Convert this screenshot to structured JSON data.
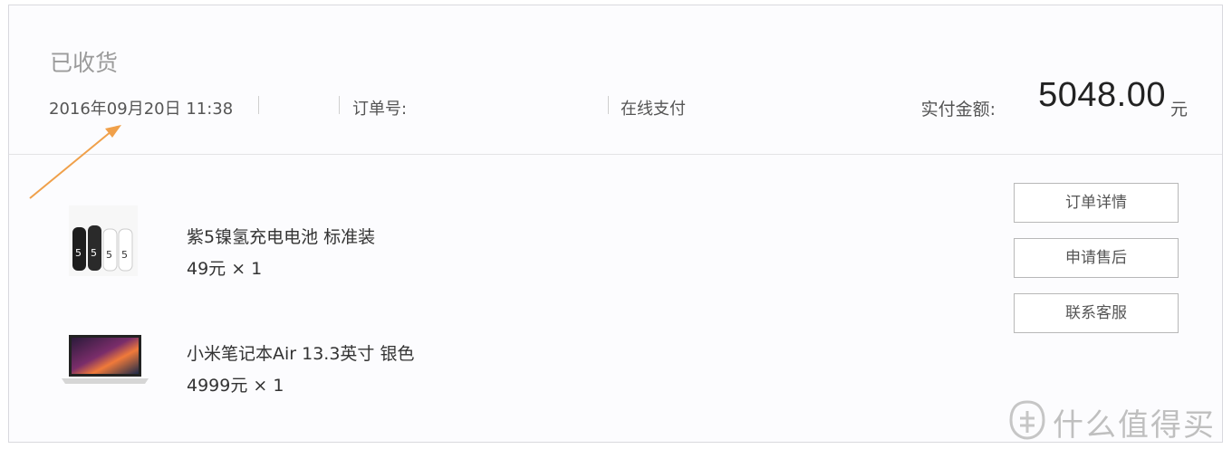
{
  "order": {
    "status": "已收货",
    "datetime": "2016年09月20日 11:38",
    "order_number_label": "订单号:",
    "payment_method": "在线支付",
    "total_label": "实付金额:",
    "total_amount": "5048.00",
    "currency_unit": "元"
  },
  "items": [
    {
      "name": "紫5镍氢充电电池 标准装",
      "price": "49元 × 1"
    },
    {
      "name": "小米笔记本Air 13.3英寸 银色",
      "price": "4999元 × 1"
    }
  ],
  "actions": {
    "order_details": "订单详情",
    "after_sales": "申请售后",
    "contact_service": "联系客服"
  },
  "watermark": {
    "text": "什么值得买"
  },
  "colors": {
    "annotation_arrow": "#f0a04a",
    "border": "#d9d9de",
    "text": "#333333"
  }
}
